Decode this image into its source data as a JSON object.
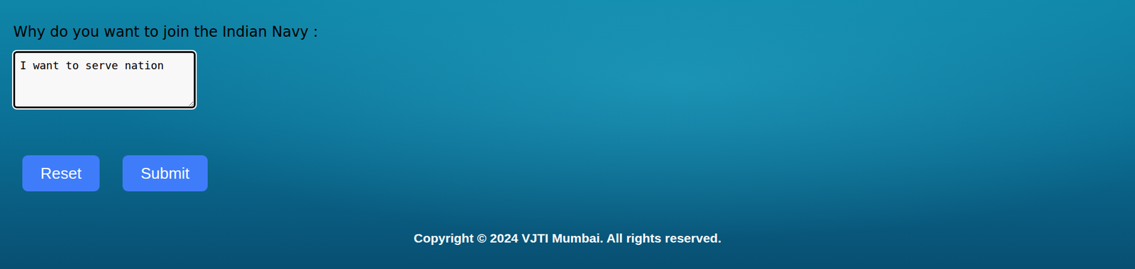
{
  "form": {
    "question": {
      "label": "Why do you want to join the Indian Navy :",
      "value": "I want to serve nation"
    },
    "buttons": [
      {
        "label": "Reset",
        "kind": "reset"
      },
      {
        "label": "Submit",
        "kind": "submit"
      }
    ]
  },
  "footer": {
    "text": "Copyright © 2024 VJTI Mumbai. All rights reserved."
  }
}
